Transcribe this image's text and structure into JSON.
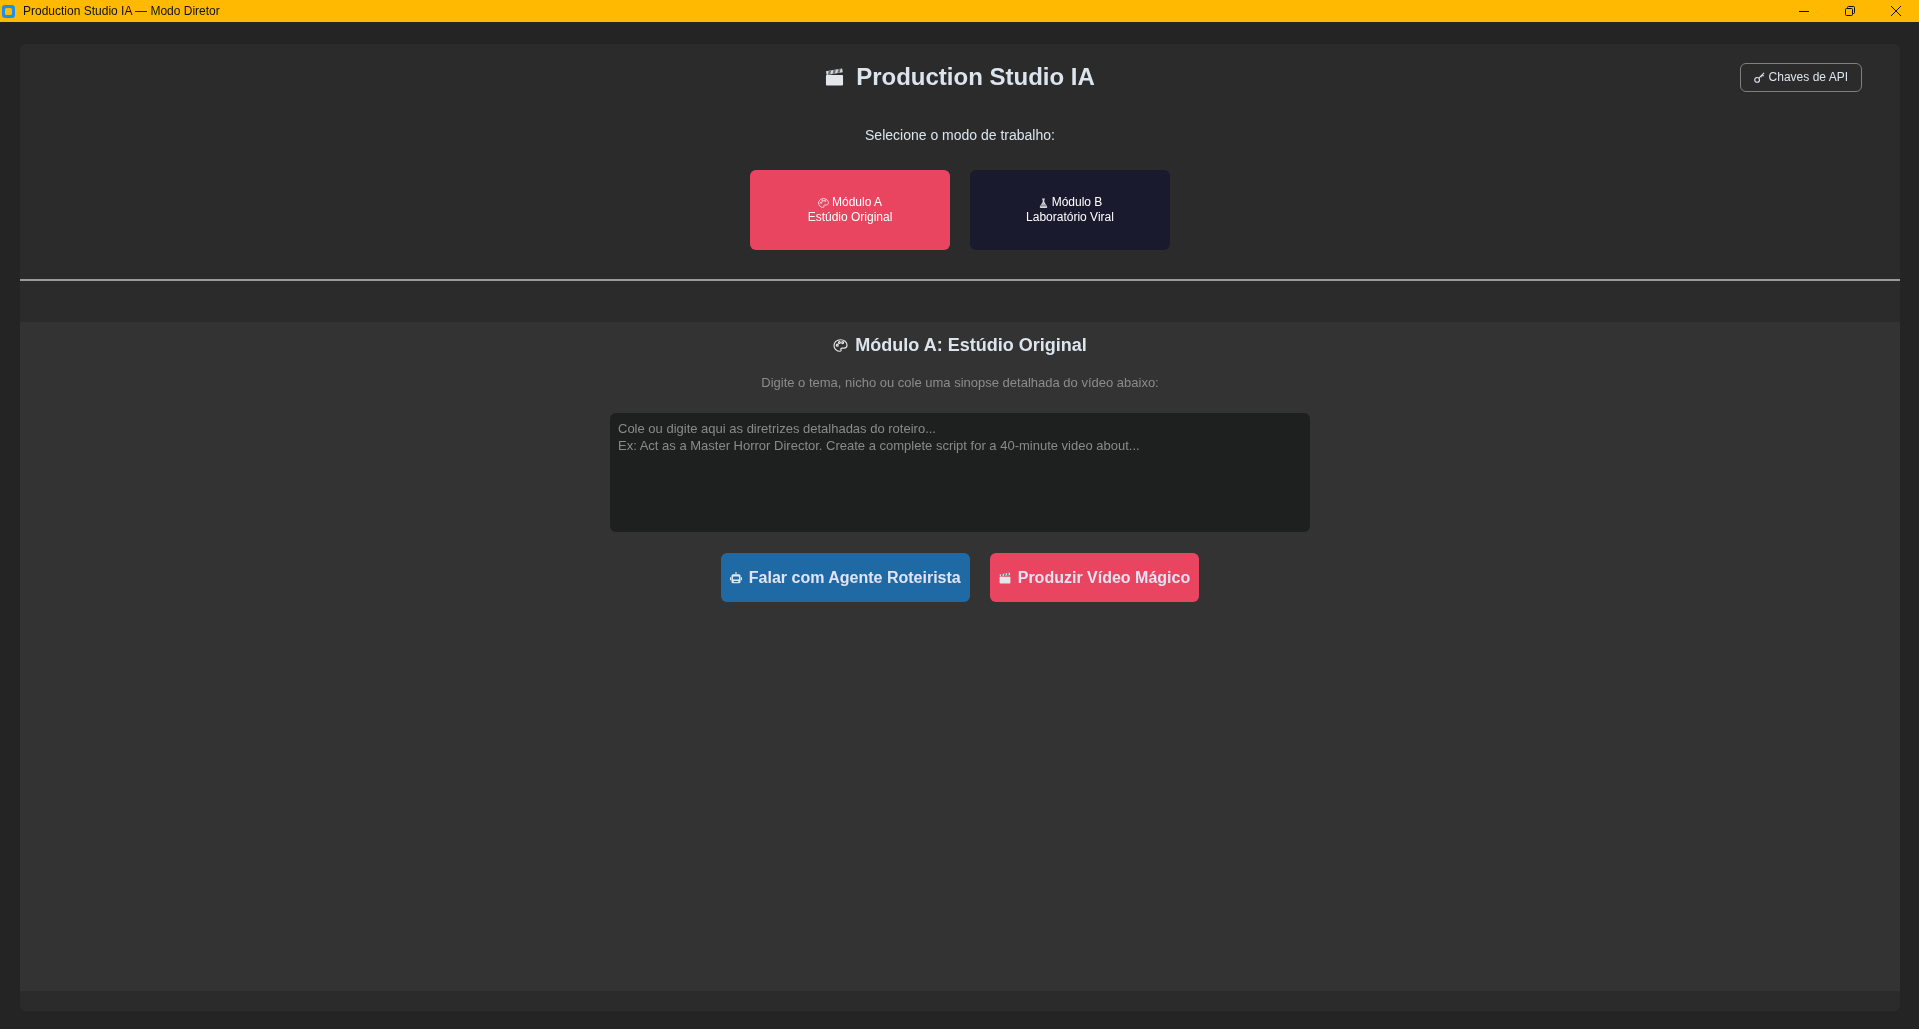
{
  "window": {
    "title": "Production Studio IA — Modo Diretor"
  },
  "header": {
    "title": "Production Studio IA",
    "api_button": "Chaves de API",
    "mode_prompt": "Selecione o modo de trabalho:"
  },
  "modes": [
    {
      "kind": "studio",
      "label": "Módulo A",
      "subtitle": "Estúdio Original",
      "selected": true
    },
    {
      "kind": "lab",
      "label": "Módulo B",
      "subtitle": "Laboratório Viral",
      "selected": false
    }
  ],
  "module": {
    "title": "Módulo A: Estúdio Original",
    "hint": "Digite o tema, nicho ou cole uma sinopse detalhada do vídeo abaixo:",
    "script_input": {
      "placeholder": "Cole ou digite aqui as diretrizes detalhadas do roteiro...\nEx: Act as a Master Horror Director. Create a complete script for a 40-minute video about..."
    }
  },
  "actions": [
    {
      "kind": "agent",
      "label": "Falar com Agente Roteirista"
    },
    {
      "kind": "produce",
      "label": "Produzir Vídeo Mágico"
    }
  ]
}
